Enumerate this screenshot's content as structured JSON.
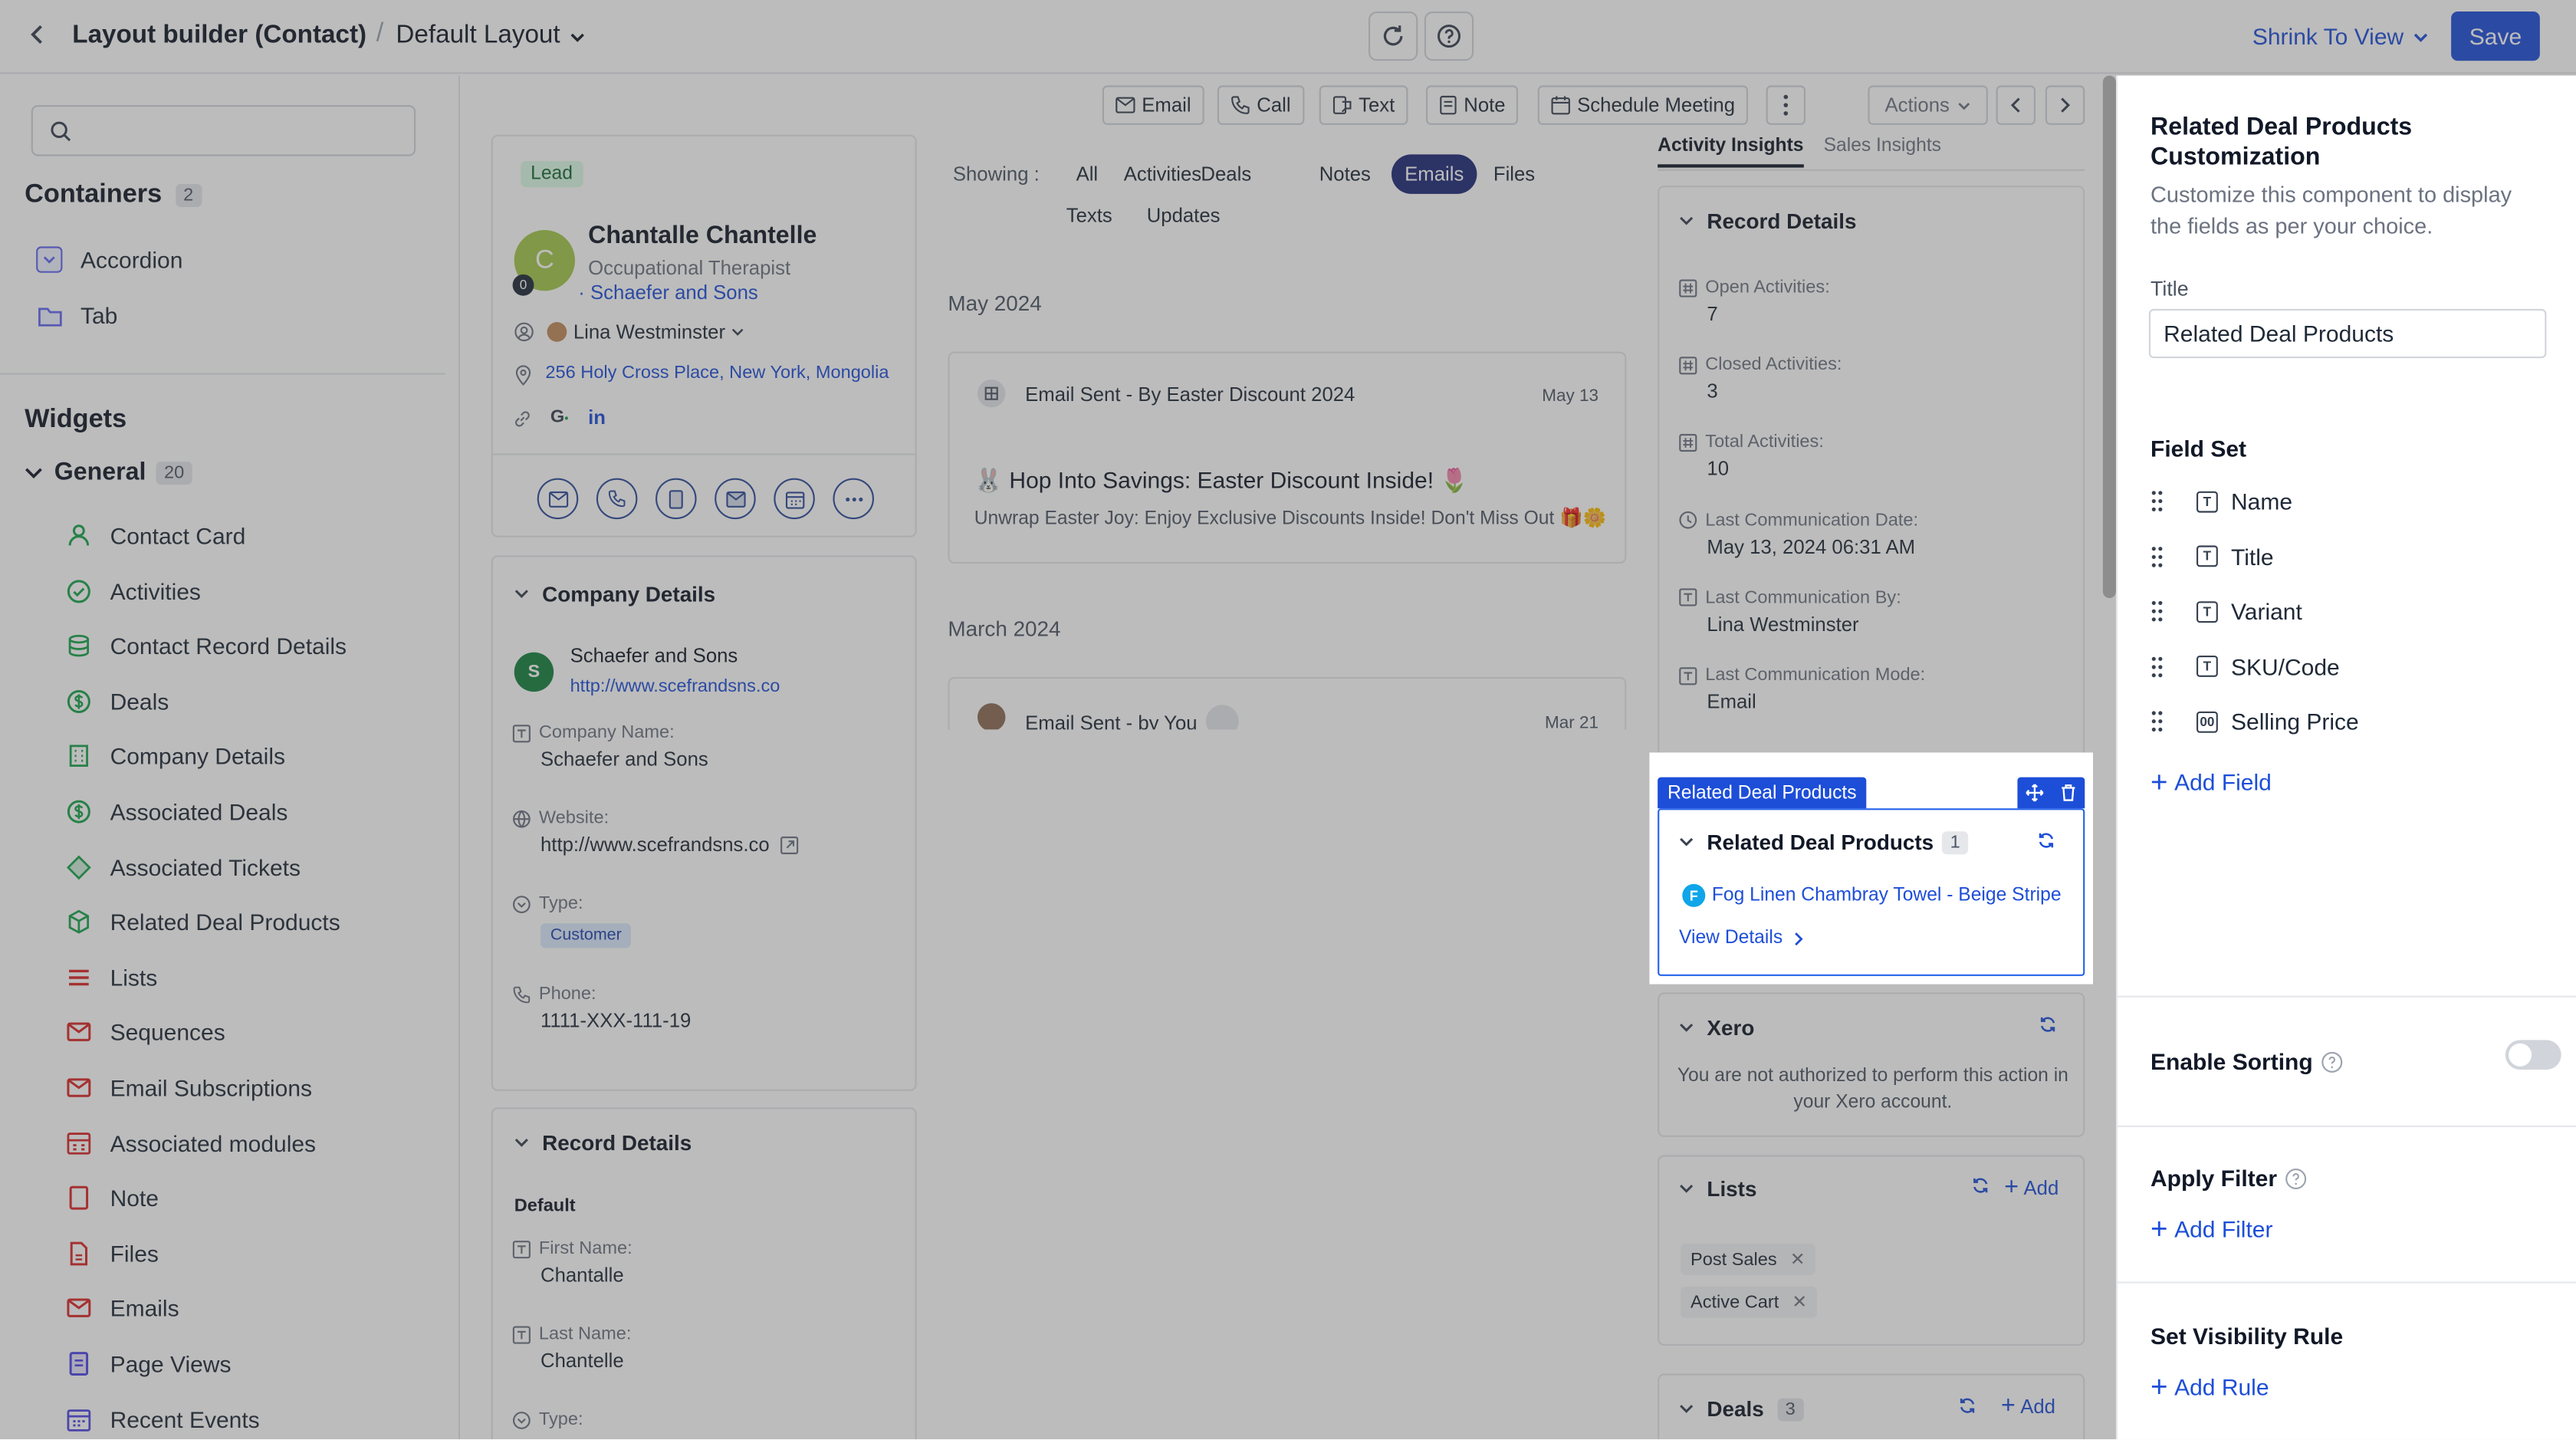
{
  "header": {
    "title": "Layout builder (Contact)",
    "separator": "/",
    "layout_name": "Default Layout",
    "shrink_label": "Shrink To View",
    "save_label": "Save"
  },
  "left_sidebar": {
    "search_placeholder": "",
    "containers_title": "Containers",
    "containers_count": "2",
    "containers": [
      {
        "label": "Accordion",
        "icon": "accordion-icon"
      },
      {
        "label": "Tab",
        "icon": "folder-tab-icon"
      }
    ],
    "widgets_title": "Widgets",
    "general_label": "General",
    "general_count": "20",
    "widgets": [
      {
        "label": "Contact Card",
        "icon": "person-icon",
        "color": "#16a34a"
      },
      {
        "label": "Activities",
        "icon": "check-circle-icon",
        "color": "#16a34a"
      },
      {
        "label": "Contact Record Details",
        "icon": "database-icon",
        "color": "#16a34a"
      },
      {
        "label": "Deals",
        "icon": "dollar-icon",
        "color": "#16a34a"
      },
      {
        "label": "Company Details",
        "icon": "building-icon",
        "color": "#16a34a"
      },
      {
        "label": "Associated Deals",
        "icon": "dollar-icon",
        "color": "#16a34a"
      },
      {
        "label": "Associated Tickets",
        "icon": "ticket-icon",
        "color": "#16a34a"
      },
      {
        "label": "Related Deal Products",
        "icon": "cube-icon",
        "color": "#16a34a"
      },
      {
        "label": "Lists",
        "icon": "list-icon",
        "color": "#dc2626"
      },
      {
        "label": "Sequences",
        "icon": "mail-sequence-icon",
        "color": "#dc2626"
      },
      {
        "label": "Email Subscriptions",
        "icon": "mail-subscription-icon",
        "color": "#dc2626"
      },
      {
        "label": "Associated modules",
        "icon": "modules-icon",
        "color": "#dc2626"
      },
      {
        "label": "Note",
        "icon": "note-icon",
        "color": "#dc2626"
      },
      {
        "label": "Files",
        "icon": "file-icon",
        "color": "#dc2626"
      },
      {
        "label": "Emails",
        "icon": "email-icon",
        "color": "#dc2626"
      },
      {
        "label": "Page Views",
        "icon": "page-view-icon",
        "color": "#4f46e5"
      },
      {
        "label": "Recent Events",
        "icon": "calendar-icon",
        "color": "#4f46e5"
      }
    ]
  },
  "toolbar": {
    "email": "Email",
    "call": "Call",
    "text": "Text",
    "note": "Note",
    "schedule": "Schedule Meeting",
    "actions": "Actions"
  },
  "contact_card": {
    "badge": "Lead",
    "avatar_letter": "C",
    "avatar_count": "0",
    "name": "Chantalle Chantelle",
    "job": "Occupational Therapist",
    "company": "Schaefer and Sons",
    "owner": "Lina Westminster",
    "address": "256 Holy Cross Place, New York, Mongolia"
  },
  "company_details": {
    "title": "Company Details",
    "avatar_letter": "S",
    "name": "Schaefer and Sons",
    "url": "http://www.scefrandsns.co",
    "fields": [
      {
        "label": "Company Name:",
        "value": "Schaefer and Sons"
      },
      {
        "label": "Website:",
        "value": "http://www.scefrandsns.co"
      },
      {
        "label": "Type:",
        "value": "Customer"
      },
      {
        "label": "Phone:",
        "value": "1111-XXX-111-19"
      }
    ]
  },
  "record_details_left": {
    "title": "Record Details",
    "group": "Default",
    "fields": [
      {
        "label": "First Name:",
        "value": "Chantalle"
      },
      {
        "label": "Last Name:",
        "value": "Chantelle"
      },
      {
        "label": "Type:",
        "value": ""
      }
    ]
  },
  "timeline": {
    "showing_label": "Showing :",
    "filters": [
      "All",
      "Activities",
      "Deals",
      "Notes",
      "Emails",
      "Files",
      "Texts",
      "Updates"
    ],
    "active_filter": "Emails",
    "month1": "May 2024",
    "email1_title": "Email Sent - By Easter Discount 2024",
    "email1_date": "May 13",
    "email1_subject": "🐰 Hop Into Savings: Easter Discount Inside! 🌷",
    "email1_preview": "Unwrap Easter Joy: Enjoy Exclusive Discounts Inside! Don't Miss Out 🎁🌼",
    "month2": "March 2024",
    "email2_title": "Email Sent - by You",
    "email2_date": "Mar 21"
  },
  "insights": {
    "tab_activity": "Activity Insights",
    "tab_sales": "Sales Insights",
    "record_title": "Record Details",
    "fields": [
      {
        "label": "Open Activities:",
        "value": "7"
      },
      {
        "label": "Closed Activities:",
        "value": "3"
      },
      {
        "label": "Total Activities:",
        "value": "10"
      },
      {
        "label": "Last Communication Date:",
        "value": "May 13, 2024 06:31 AM"
      },
      {
        "label": "Last Communication By:",
        "value": "Lina Westminster"
      },
      {
        "label": "Last Communication Mode:",
        "value": "Email"
      }
    ]
  },
  "rdp_widget": {
    "tag": "Related Deal Products",
    "title": "Related Deal Products",
    "count": "1",
    "product_letter": "F",
    "product": "Fog Linen Chambray Towel - Beige Stripe",
    "view_details": "View Details"
  },
  "xero": {
    "title": "Xero",
    "message": "You are not authorized to perform this action in your Xero account."
  },
  "lists_card": {
    "title": "Lists",
    "add": "Add",
    "tags": [
      "Post Sales",
      "Active Cart"
    ]
  },
  "deals_card": {
    "title": "Deals",
    "count": "3",
    "add": "Add"
  },
  "right_panel": {
    "title": "Related Deal Products Customization",
    "description": "Customize this component to display the fields as per your choice.",
    "title_label": "Title",
    "title_value": "Related Deal Products",
    "field_set_title": "Field Set",
    "fields": [
      {
        "label": "Name",
        "type": "T"
      },
      {
        "label": "Title",
        "type": "T"
      },
      {
        "label": "Variant",
        "type": "T"
      },
      {
        "label": "SKU/Code",
        "type": "T"
      },
      {
        "label": "Selling Price",
        "type": "00"
      }
    ],
    "add_field": "Add Field",
    "sorting_label": "Enable Sorting",
    "sorting_enabled": false,
    "filter_label": "Apply Filter",
    "add_filter": "Add Filter",
    "visibility_label": "Set Visibility Rule",
    "add_rule": "Add Rule"
  },
  "colors": {
    "primary": "#1d4ed8",
    "highlight_border": "#2563eb",
    "active_filter_bg": "#1e2a78"
  }
}
